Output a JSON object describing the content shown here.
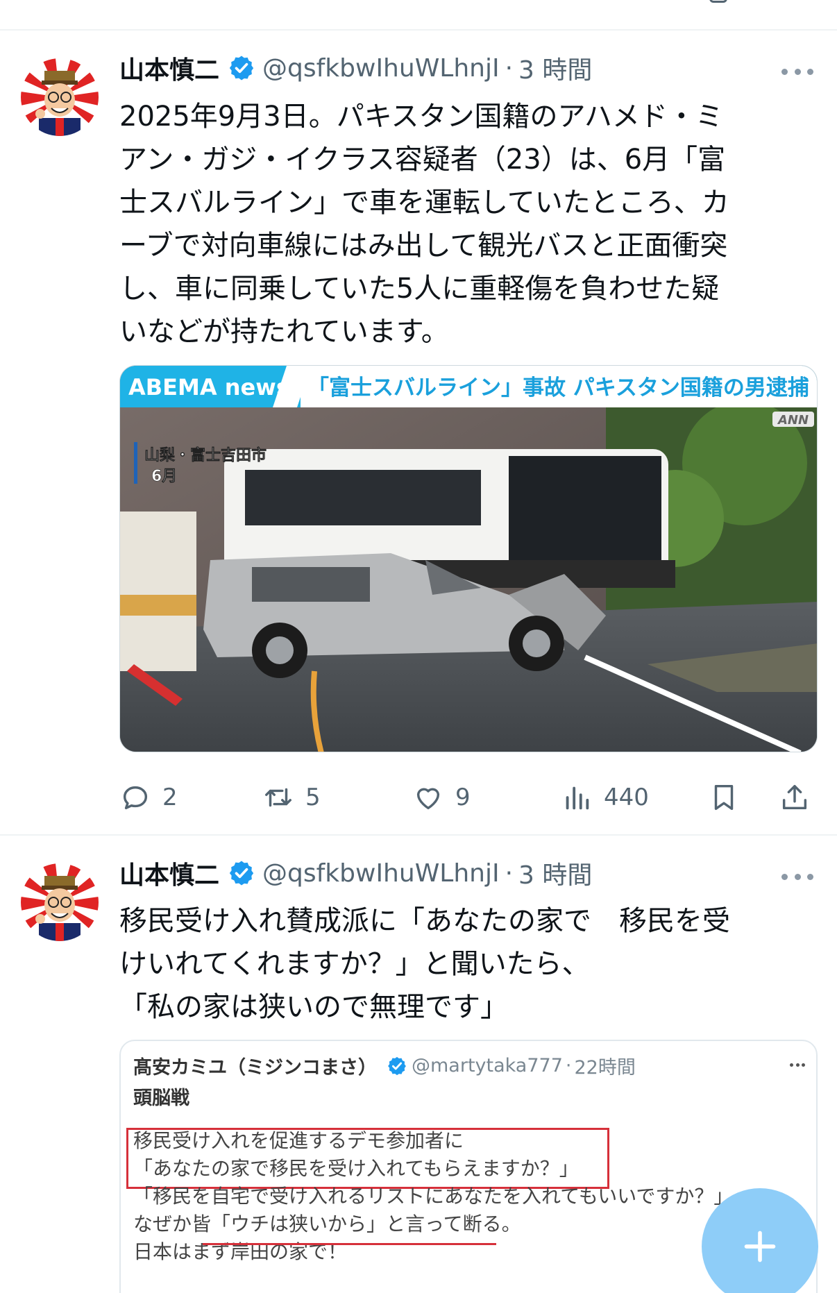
{
  "top_strip": {
    "icon": "partial-action-icon"
  },
  "posts": [
    {
      "author_name": "山本慎二",
      "handle": "@qsfkbwIhuWLhnjI",
      "separator": "·",
      "time": "3 時間",
      "text_lines": [
        "2025年9月3日。パキスタン国籍のアハメド・ミ",
        "アン・ガジ・イクラス容疑者（23）は、6月「富",
        "士スバルライン」で車を運転していたところ、カ",
        "ーブで対向車線にはみ出して観光バスと正面衝突",
        "し、車に同乗していた5人に重軽傷を負わせた疑",
        "いなどが持たれています。"
      ],
      "media": {
        "brand": "ABEMA news/",
        "headline": "「富士スバルライン」事故 パキスタン国籍の男逮捕",
        "corner_logo": "ANN",
        "location": "山梨・富士吉田市",
        "month": "6月"
      },
      "actions": {
        "reply_count": "2",
        "retweet_count": "5",
        "like_count": "9",
        "views_count": "440"
      }
    },
    {
      "author_name": "山本慎二",
      "handle": "@qsfkbwIhuWLhnjI",
      "separator": "·",
      "time": "3 時間",
      "text_lines": [
        "移民受け入れ賛成派に「あなたの家で　移民を受",
        "けいれてくれますか？」と聞いたら、",
        "「私の家は狭いので無理です」"
      ],
      "quote": {
        "author_name": "髙安カミユ（ミジンコまさ）",
        "handle": "@martytaka777",
        "separator": "·",
        "time": "22時間",
        "title": "頭脳戦",
        "lines": [
          "移民受け入れを促進するデモ参加者に",
          "「あなたの家で移民を受け入れてもらえますか？」",
          "「移民を自宅で受け入れるリストにあなたを入れてもいいですか？」",
          "なぜか皆「ウチは狭いから」と言って断る。",
          "日本はまず岸田の家で！"
        ]
      }
    }
  ],
  "fab": {
    "icon": "plus-icon",
    "color": "#8ecdf8"
  },
  "colors": {
    "verified": "#1d9bf0",
    "secondary_text": "#536471",
    "highlight_red": "#d6303a"
  }
}
